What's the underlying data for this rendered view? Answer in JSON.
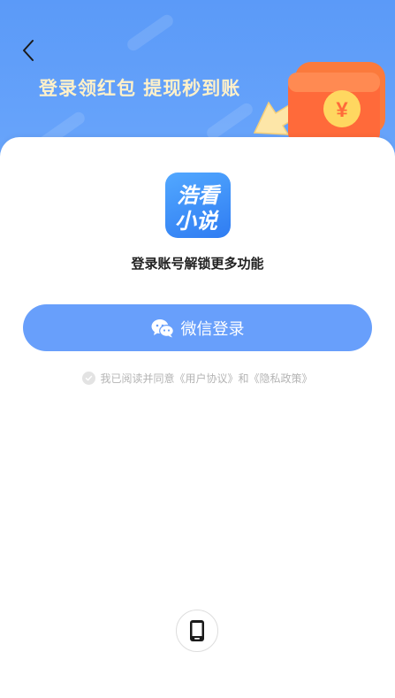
{
  "banner": {
    "title": "登录领红包 提现秒到账",
    "back_icon": "chevron-left-icon",
    "gift_icon": "red-envelope-gift-icon",
    "background_color": "#5b9af8",
    "title_color": "#fff1c9"
  },
  "app": {
    "logo_text": "浩看小说",
    "logo_icon": "app-logo-icon"
  },
  "main": {
    "subtitle": "登录账号解锁更多功能",
    "wechat_login_label": "微信登录",
    "wechat_icon": "wechat-icon",
    "button_color": "#689ffb"
  },
  "agreement": {
    "prefix": "我已阅读并同意",
    "user_agreement": "《用户协议》",
    "connector": "和",
    "privacy_policy": "《隐私政策》",
    "checked": false
  },
  "alt_login": {
    "phone_icon": "phone-icon"
  }
}
